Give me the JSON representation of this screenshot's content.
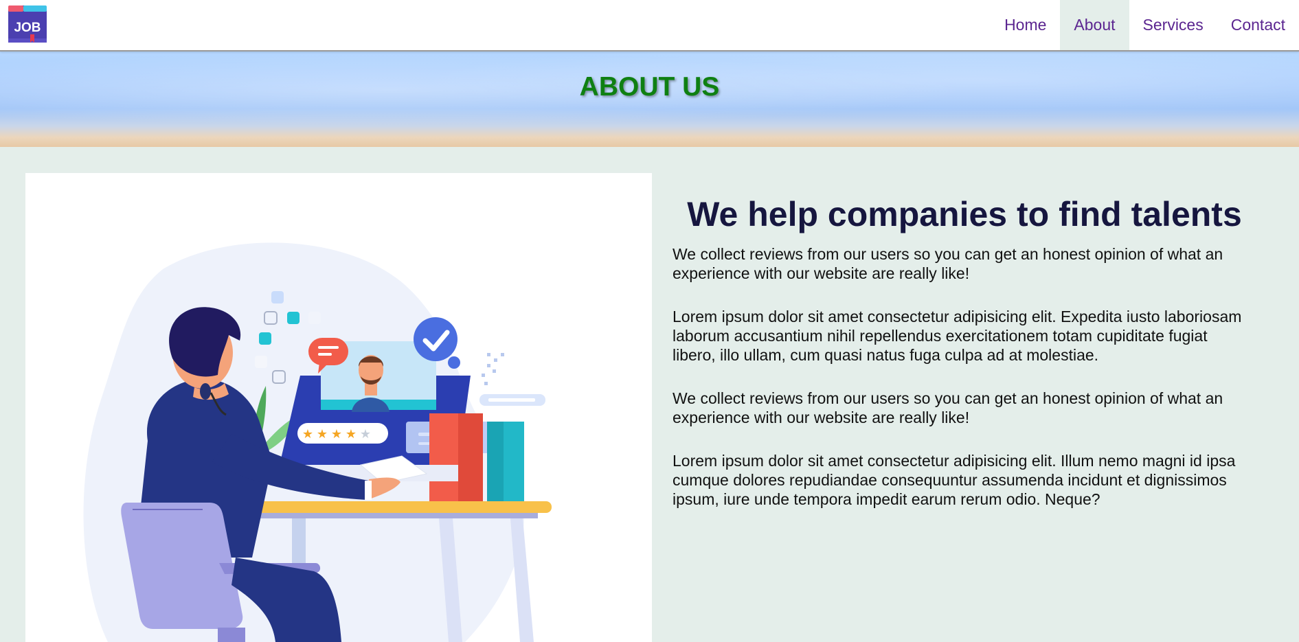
{
  "brand": {
    "logo_text": "JOB",
    "colors": {
      "nav_text": "#5b2590",
      "hero_title": "#0f8012",
      "headline": "#16163f",
      "background": "#e4eeea"
    }
  },
  "nav": {
    "items": [
      {
        "label": "Home",
        "active": false
      },
      {
        "label": "About",
        "active": true
      },
      {
        "label": "Services",
        "active": false
      },
      {
        "label": "Contact",
        "active": false
      }
    ]
  },
  "hero": {
    "title": "ABOUT US"
  },
  "illustration": {
    "icon": "recruiter-video-call-illustration",
    "rating_stars": 4,
    "rating_max": 5
  },
  "content": {
    "headline": "We help companies to find talents",
    "paragraphs": [
      "We collect reviews from our users so you can get an honest opinion of what an experience with our website are really like!",
      "Lorem ipsum dolor sit amet consectetur adipisicing elit. Expedita iusto laboriosam laborum accusantium nihil repellendus exercitationem totam cupiditate fugiat libero, illo ullam, cum quasi natus fuga culpa ad at molestiae.",
      "We collect reviews from our users so you can get an honest opinion of what an experience with our website are really like!",
      "Lorem ipsum dolor sit amet consectetur adipisicing elit. Illum nemo magni id ipsa cumque dolores repudiandae consequuntur assumenda incidunt et dignissimos ipsum, iure unde tempora impedit earum rerum odio. Neque?"
    ]
  }
}
